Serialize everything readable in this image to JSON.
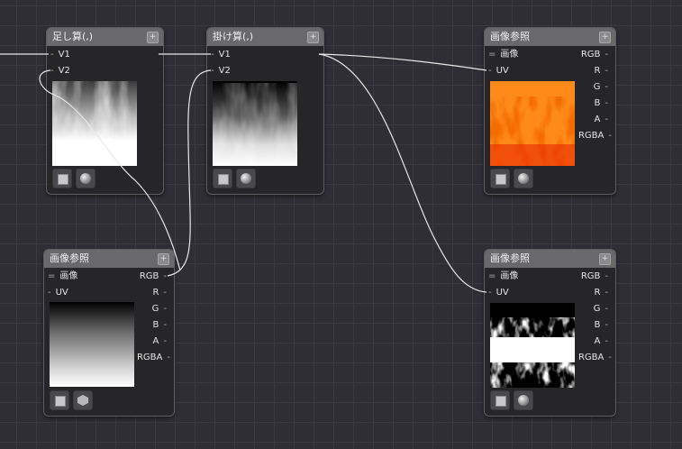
{
  "nodes": {
    "add": {
      "title": "足し算(,)",
      "add_button": "+",
      "inputs": [
        "V1",
        "V2"
      ]
    },
    "multiply": {
      "title": "掛け算(,)",
      "add_button": "+",
      "inputs": [
        "V1",
        "V2"
      ]
    },
    "image_ref_top": {
      "title": "画像参照",
      "add_button": "+",
      "image_label": "画像",
      "uv_label": "UV",
      "outputs": [
        "RGB",
        "R",
        "G",
        "B",
        "A",
        "RGBA"
      ]
    },
    "image_ref_left": {
      "title": "画像参照",
      "add_button": "+",
      "image_label": "画像",
      "uv_label": "UV",
      "outputs": [
        "RGB",
        "R",
        "G",
        "B",
        "A",
        "RGBA"
      ]
    },
    "image_ref_bottom": {
      "title": "画像参照",
      "add_button": "+",
      "image_label": "画像",
      "uv_label": "UV",
      "outputs": [
        "RGB",
        "R",
        "G",
        "B",
        "A",
        "RGBA"
      ]
    }
  },
  "colors": {
    "background": "#2f2e35",
    "grid": "#3a3941",
    "node_body": "#262628",
    "node_header": "#69696c",
    "wire": "#e8e8e8",
    "fire_orange": "#ff8a1a",
    "fire_red": "#e82a00"
  }
}
